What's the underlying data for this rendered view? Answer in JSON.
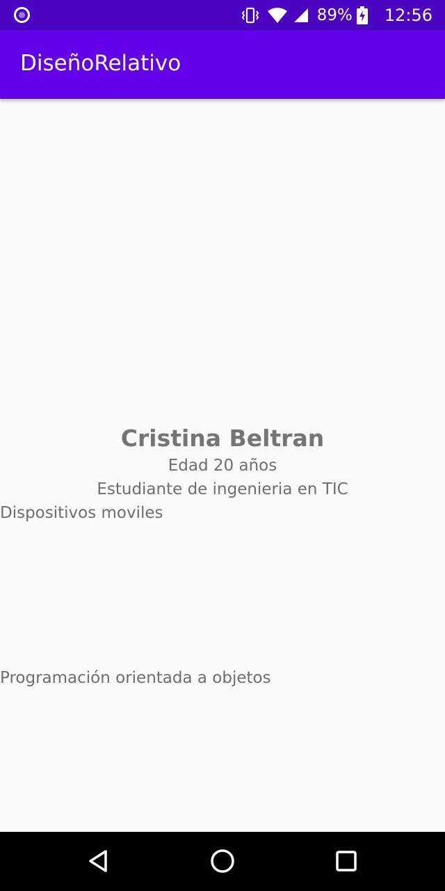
{
  "status_bar": {
    "battery_percent": "89%",
    "time": "12:56",
    "icons": [
      "app-notification-icon",
      "vibrate-icon",
      "wifi-icon",
      "signal-icon",
      "battery-charging-icon"
    ]
  },
  "app_bar": {
    "title": "DiseñoRelativo"
  },
  "content": {
    "name": "Cristina Beltran",
    "age": "Edad 20 años",
    "study": "Estudiante de ingenieria en TIC",
    "course_1": "Dispositivos moviles",
    "course_2": "Programación orientada a objetos"
  },
  "nav_bar": {
    "icons": [
      "back-icon",
      "home-icon",
      "recents-icon"
    ]
  },
  "colors": {
    "status_bar": "#4b05c2",
    "app_bar": "#6200ea",
    "background": "#fafafa",
    "text": "#6e6e6e"
  }
}
